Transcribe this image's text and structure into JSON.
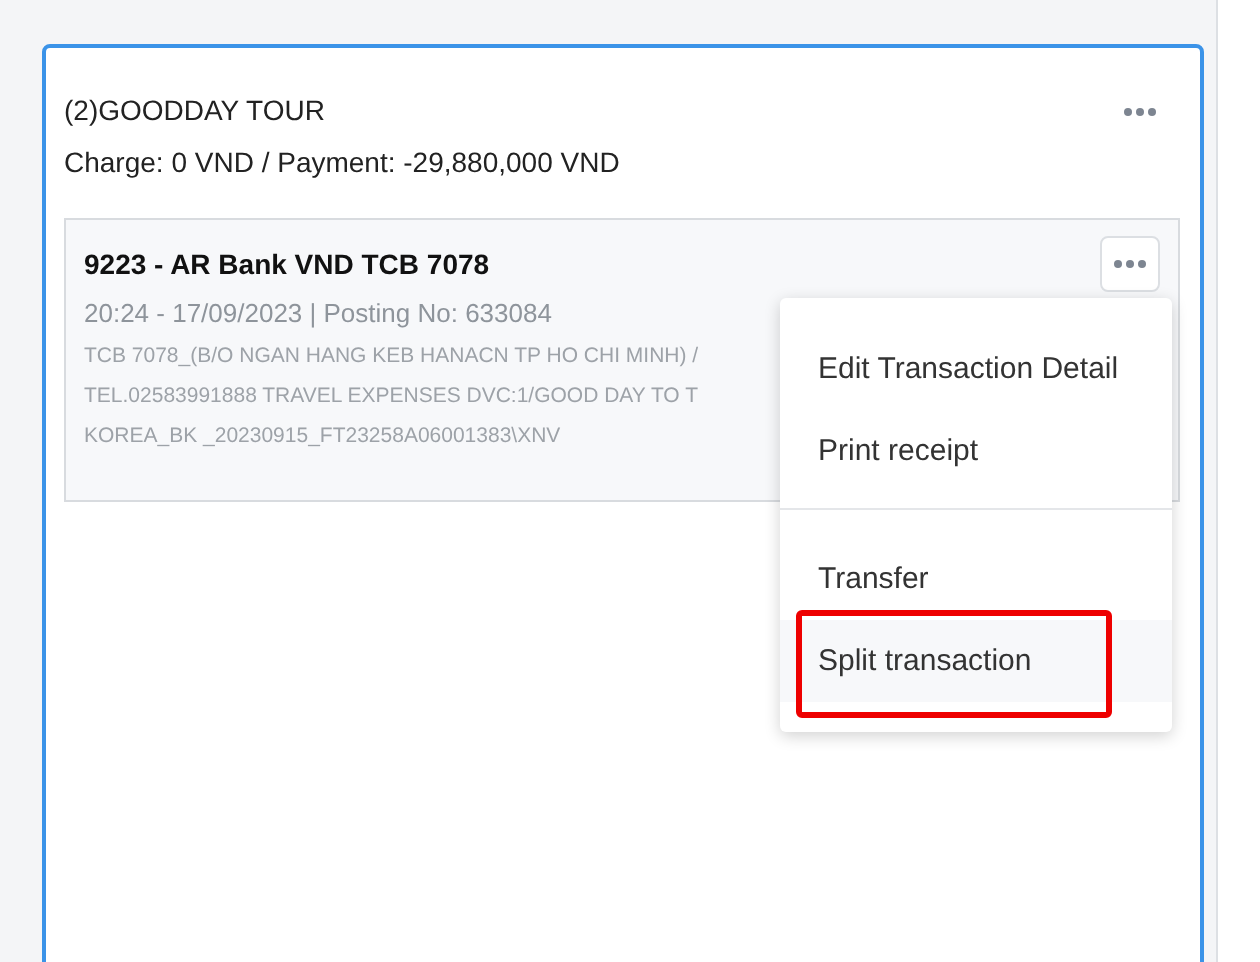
{
  "group": {
    "title": "(2)GOODDAY TOUR",
    "summary": "Charge: 0 VND / Payment: -29,880,000 VND"
  },
  "transaction": {
    "title": "9223 - AR Bank VND TCB 7078",
    "meta": "20:24 - 17/09/2023 | Posting No: 633084",
    "description": [
      "TCB 7078_(B/O NGAN HANG KEB HANACN TP HO CHI MINH) /",
      "TEL.02583991888 TRAVEL EXPENSES DVC:1/GOOD DAY TO T",
      "KOREA_BK _20230915_FT23258A06001383\\XNV"
    ]
  },
  "menu": {
    "sections": [
      {
        "items": [
          {
            "label": "Edit Transaction Detail",
            "hovered": false,
            "highlighted": false
          },
          {
            "label": "Print receipt",
            "hovered": false,
            "highlighted": false
          }
        ]
      },
      {
        "items": [
          {
            "label": "Transfer",
            "hovered": false,
            "highlighted": false
          },
          {
            "label": "Split transaction",
            "hovered": true,
            "highlighted": true
          }
        ]
      }
    ]
  }
}
